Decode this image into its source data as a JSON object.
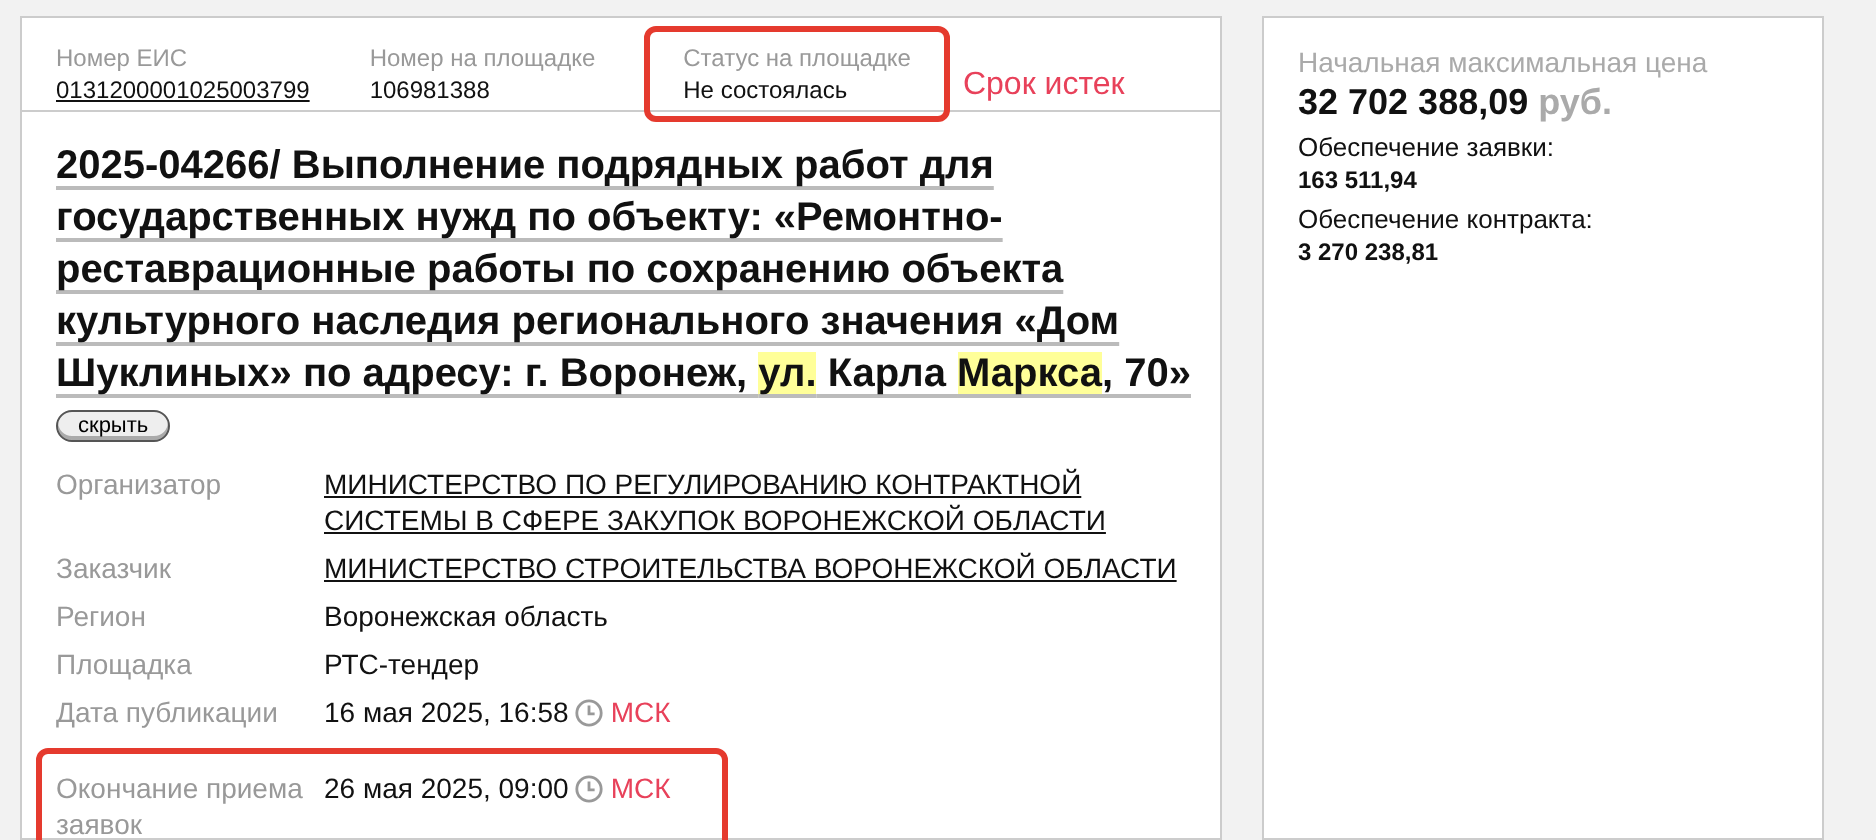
{
  "header": {
    "fields": [
      {
        "label": "Номер ЕИС",
        "value": "0131200001025003799",
        "link": true,
        "highlighted": false
      },
      {
        "label": "Номер на площадке",
        "value": "106981388",
        "link": false,
        "highlighted": false
      },
      {
        "label": "Статус на площадке",
        "value": "Не состоялась",
        "link": false,
        "highlighted": true
      }
    ],
    "status_note": "Срок истек"
  },
  "title": [
    {
      "text": "2025-04266/ Выполнение подрядных работ для государственных нужд по объекту: «Ремонтно-реставрационные работы по сохранению объекта культурного наследия регионального значения «Дом Шуклиных» по адресу: г. Воронеж, ",
      "highlight": false
    },
    {
      "text": "ул.",
      "highlight": true
    },
    {
      "text": " Карла ",
      "highlight": false
    },
    {
      "text": "Маркса",
      "highlight": true
    },
    {
      "text": ", 70»",
      "highlight": false
    }
  ],
  "toggle_button": "скрыть",
  "details": [
    {
      "label": "Организатор",
      "value": "МИНИСТЕРСТВО ПО РЕГУЛИРОВАНИЮ КОНТРАКТНОЙ СИСТЕМЫ В СФЕРЕ ЗАКУПОК ВОРОНЕЖСКОЙ ОБЛАСТИ",
      "kind": "link",
      "highlighted": false
    },
    {
      "label": "Заказчик",
      "value": "МИНИСТЕРСТВО СТРОИТЕЛЬСТВА ВОРОНЕЖСКОЙ ОБЛАСТИ",
      "kind": "link",
      "highlighted": false
    },
    {
      "label": "Регион",
      "value": "Воронежская область",
      "kind": "text",
      "highlighted": false
    },
    {
      "label": "Площадка",
      "value": "РТС-тендер",
      "kind": "text",
      "highlighted": false
    },
    {
      "label": "Дата публикации",
      "value": "16 мая 2025, 16:58",
      "zone": "МСК",
      "kind": "time",
      "highlighted": false
    },
    {
      "label": "Окончание приема заявок",
      "value": "26 мая 2025, 09:00",
      "zone": "МСК",
      "kind": "time",
      "highlighted": true
    }
  ],
  "price": {
    "label": "Начальная максимальная цена",
    "amount": "32 702 388,09",
    "currency": "руб.",
    "items": [
      {
        "label": "Обеспечение заявки:",
        "value": "163 511,94"
      },
      {
        "label": "Обеспечение контракта:",
        "value": "3 270 238,81"
      }
    ]
  }
}
